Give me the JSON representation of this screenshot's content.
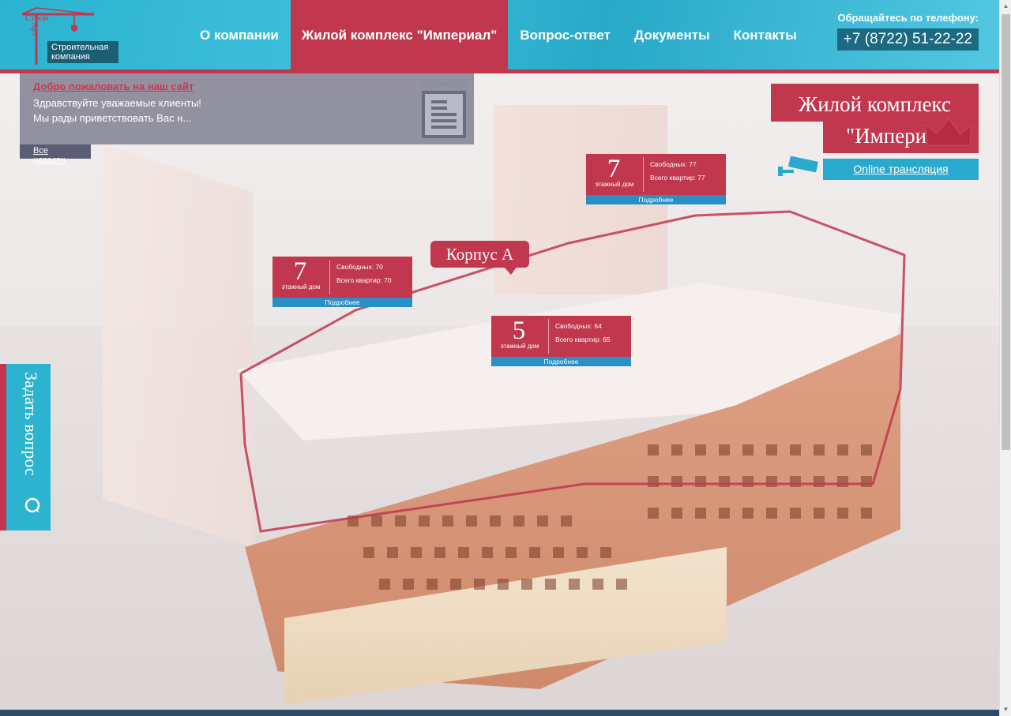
{
  "header": {
    "logo": {
      "word1": "Строй",
      "word2": "Арт",
      "tagline": "Строительная компания"
    },
    "nav": [
      {
        "label": "О компании",
        "active": false
      },
      {
        "label": "Жилой комплекс \"Империал\"",
        "active": true
      },
      {
        "label": "Вопрос-ответ",
        "active": false
      },
      {
        "label": "Документы",
        "active": false
      },
      {
        "label": "Контакты",
        "active": false
      }
    ],
    "phone_label": "Обращайтесь по телефону:",
    "phone": "+7 (8722) 51-22-22"
  },
  "news": {
    "title": "Добро пожаловать на наш сайт",
    "text_line1": "Здравствуйте уважаемые клиенты!",
    "text_line2": "Мы рады приветствовать Вас н...",
    "label": "Новости",
    "all_link": "Все новости"
  },
  "complex": {
    "title_line1": "Жилой комплекс",
    "title_line2": "\"Империал\"",
    "online_link": "Online трансляция"
  },
  "corpus_label": "Корпус А",
  "cards": [
    {
      "floors": "7",
      "unit": "этажный дом",
      "free": "Свободных: 77",
      "total": "Всего квартир: 77",
      "more": "Подробнее"
    },
    {
      "floors": "7",
      "unit": "этажный дом",
      "free": "Свободных: 70",
      "total": "Всего квартир: 70",
      "more": "Подробнее"
    },
    {
      "floors": "5",
      "unit": "этажный дом",
      "free": "Свободных: 64",
      "total": "Всего квартир: 65",
      "more": "Подробнее"
    }
  ],
  "ask_question": "Задать вопрос",
  "colors": {
    "accent_red": "#c0374e",
    "header_blue": "#2bb3cf",
    "link_blue": "#2a8fc4"
  }
}
